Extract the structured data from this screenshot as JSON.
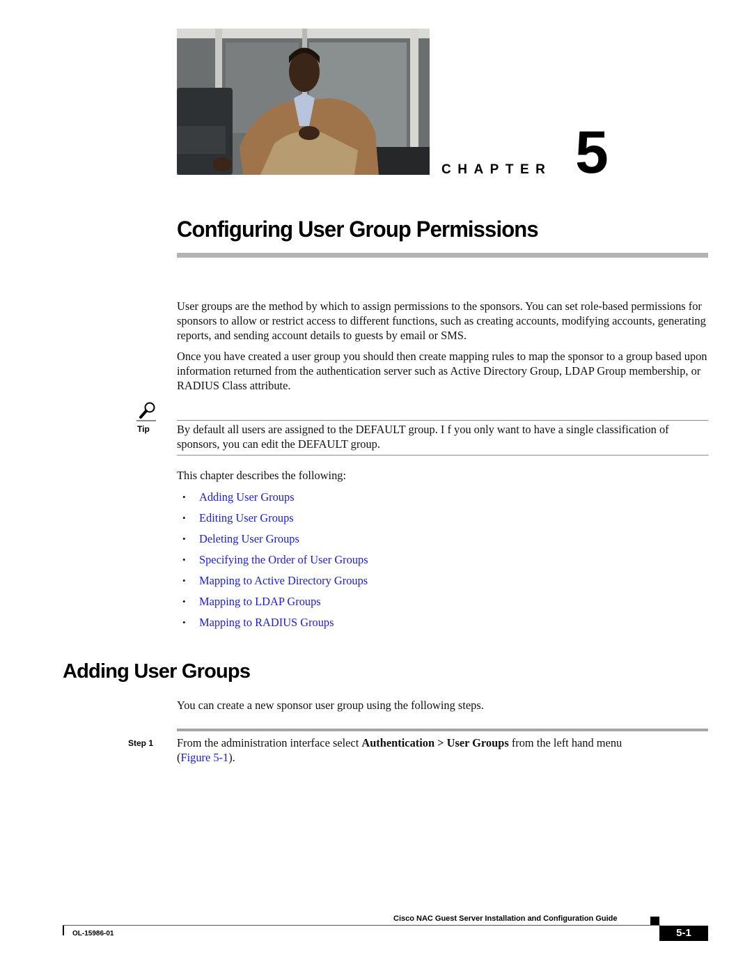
{
  "chapter": {
    "label": "CHAPTER",
    "number": "5",
    "photo_alt": "man seated in armchair",
    "title": "Configuring User Group Permissions"
  },
  "body": {
    "paragraph1": "User groups are the method by which to assign permissions to the sponsors. You can set role-based permissions for sponsors to allow or restrict access to different functions, such as creating accounts, modifying accounts, generating reports, and sending account details to guests by email or SMS.",
    "paragraph2": "Once you have created a user group you should then create mapping rules to map the sponsor to a group based upon information returned from the authentication server such as Active Directory Group, LDAP Group membership, or RADIUS Class attribute."
  },
  "tip": {
    "icon": "magnifier-icon",
    "label": "Tip",
    "text": "By default all users are assigned to the DEFAULT group. I f you only want to have a single classification of sponsors, you can edit the DEFAULT group."
  },
  "toc": {
    "intro": "This chapter describes the following:",
    "bullet": "•",
    "items": [
      {
        "label": "Adding User Groups"
      },
      {
        "label": "Editing User Groups"
      },
      {
        "label": "Deleting User Groups"
      },
      {
        "label": "Specifying the Order of User Groups"
      },
      {
        "label": "Mapping to Active Directory Groups"
      },
      {
        "label": "Mapping to LDAP Groups"
      },
      {
        "label": "Mapping to RADIUS Groups"
      }
    ]
  },
  "section": {
    "heading": "Adding User Groups",
    "intro": "You can create a new sponsor user group using the following steps.",
    "step": {
      "label": "Step 1",
      "text_before": "From the administration interface select ",
      "bold": "Authentication > User Groups",
      "text_after": " from the left hand menu ",
      "paren_open": "(",
      "link": "Figure 5-1",
      "paren_close": ")."
    }
  },
  "footer": {
    "guide_title": "Cisco NAC Guest Server Installation and Configuration Guide",
    "doc_id": "OL-15986-01",
    "page": "5-1"
  },
  "colors": {
    "link": "#1a1ae6",
    "rule": "#b3b3b3",
    "text": "#111111"
  }
}
